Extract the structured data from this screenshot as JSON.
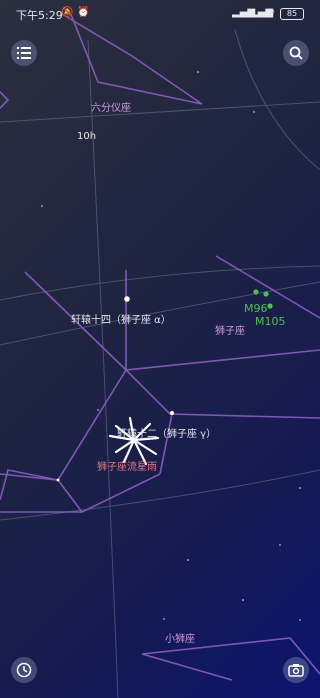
{
  "status_bar": {
    "time": "下午5:29",
    "battery": "85"
  },
  "labels": {
    "constellation_sextans": "六分仪座",
    "ra_10h": "10h",
    "star_alpha_leo": "轩辕十四（狮子座 α）",
    "constellation_leo": "狮子座",
    "galaxy_m96": "M96",
    "galaxy_m105": "M105",
    "star_gamma_leo": "轩辕十二（狮子座 γ）",
    "meteor_shower": "狮子座流星雨",
    "constellation_leo_minor": "小狮座"
  },
  "icons": {
    "menu": "list-icon",
    "search": "search-icon",
    "clock": "clock-icon",
    "camera": "camera-icon"
  },
  "colors": {
    "constellation_line": "#8a5fc0",
    "grid_line": "#6f7896",
    "star_label": "#e6e6ee",
    "constellation_label": "#c99bdb",
    "galaxy": "#4fc04f",
    "meteor_label": "#e07a84"
  }
}
